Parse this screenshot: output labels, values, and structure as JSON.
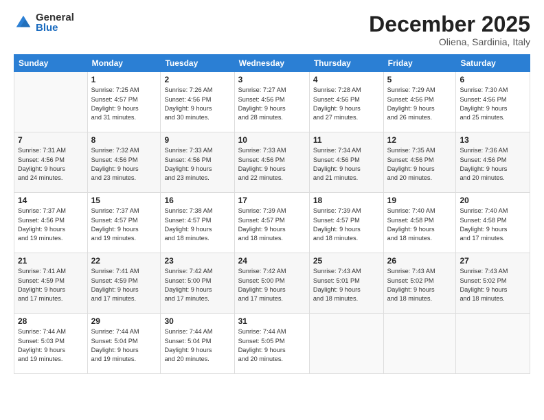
{
  "logo": {
    "general": "General",
    "blue": "Blue"
  },
  "title": "December 2025",
  "subtitle": "Oliena, Sardinia, Italy",
  "days_header": [
    "Sunday",
    "Monday",
    "Tuesday",
    "Wednesday",
    "Thursday",
    "Friday",
    "Saturday"
  ],
  "weeks": [
    [
      {
        "day": "",
        "detail": ""
      },
      {
        "day": "1",
        "detail": "Sunrise: 7:25 AM\nSunset: 4:57 PM\nDaylight: 9 hours\nand 31 minutes."
      },
      {
        "day": "2",
        "detail": "Sunrise: 7:26 AM\nSunset: 4:56 PM\nDaylight: 9 hours\nand 30 minutes."
      },
      {
        "day": "3",
        "detail": "Sunrise: 7:27 AM\nSunset: 4:56 PM\nDaylight: 9 hours\nand 28 minutes."
      },
      {
        "day": "4",
        "detail": "Sunrise: 7:28 AM\nSunset: 4:56 PM\nDaylight: 9 hours\nand 27 minutes."
      },
      {
        "day": "5",
        "detail": "Sunrise: 7:29 AM\nSunset: 4:56 PM\nDaylight: 9 hours\nand 26 minutes."
      },
      {
        "day": "6",
        "detail": "Sunrise: 7:30 AM\nSunset: 4:56 PM\nDaylight: 9 hours\nand 25 minutes."
      }
    ],
    [
      {
        "day": "7",
        "detail": "Sunrise: 7:31 AM\nSunset: 4:56 PM\nDaylight: 9 hours\nand 24 minutes."
      },
      {
        "day": "8",
        "detail": "Sunrise: 7:32 AM\nSunset: 4:56 PM\nDaylight: 9 hours\nand 23 minutes."
      },
      {
        "day": "9",
        "detail": "Sunrise: 7:33 AM\nSunset: 4:56 PM\nDaylight: 9 hours\nand 23 minutes."
      },
      {
        "day": "10",
        "detail": "Sunrise: 7:33 AM\nSunset: 4:56 PM\nDaylight: 9 hours\nand 22 minutes."
      },
      {
        "day": "11",
        "detail": "Sunrise: 7:34 AM\nSunset: 4:56 PM\nDaylight: 9 hours\nand 21 minutes."
      },
      {
        "day": "12",
        "detail": "Sunrise: 7:35 AM\nSunset: 4:56 PM\nDaylight: 9 hours\nand 20 minutes."
      },
      {
        "day": "13",
        "detail": "Sunrise: 7:36 AM\nSunset: 4:56 PM\nDaylight: 9 hours\nand 20 minutes."
      }
    ],
    [
      {
        "day": "14",
        "detail": "Sunrise: 7:37 AM\nSunset: 4:56 PM\nDaylight: 9 hours\nand 19 minutes."
      },
      {
        "day": "15",
        "detail": "Sunrise: 7:37 AM\nSunset: 4:57 PM\nDaylight: 9 hours\nand 19 minutes."
      },
      {
        "day": "16",
        "detail": "Sunrise: 7:38 AM\nSunset: 4:57 PM\nDaylight: 9 hours\nand 18 minutes."
      },
      {
        "day": "17",
        "detail": "Sunrise: 7:39 AM\nSunset: 4:57 PM\nDaylight: 9 hours\nand 18 minutes."
      },
      {
        "day": "18",
        "detail": "Sunrise: 7:39 AM\nSunset: 4:57 PM\nDaylight: 9 hours\nand 18 minutes."
      },
      {
        "day": "19",
        "detail": "Sunrise: 7:40 AM\nSunset: 4:58 PM\nDaylight: 9 hours\nand 18 minutes."
      },
      {
        "day": "20",
        "detail": "Sunrise: 7:40 AM\nSunset: 4:58 PM\nDaylight: 9 hours\nand 17 minutes."
      }
    ],
    [
      {
        "day": "21",
        "detail": "Sunrise: 7:41 AM\nSunset: 4:59 PM\nDaylight: 9 hours\nand 17 minutes."
      },
      {
        "day": "22",
        "detail": "Sunrise: 7:41 AM\nSunset: 4:59 PM\nDaylight: 9 hours\nand 17 minutes."
      },
      {
        "day": "23",
        "detail": "Sunrise: 7:42 AM\nSunset: 5:00 PM\nDaylight: 9 hours\nand 17 minutes."
      },
      {
        "day": "24",
        "detail": "Sunrise: 7:42 AM\nSunset: 5:00 PM\nDaylight: 9 hours\nand 17 minutes."
      },
      {
        "day": "25",
        "detail": "Sunrise: 7:43 AM\nSunset: 5:01 PM\nDaylight: 9 hours\nand 18 minutes."
      },
      {
        "day": "26",
        "detail": "Sunrise: 7:43 AM\nSunset: 5:02 PM\nDaylight: 9 hours\nand 18 minutes."
      },
      {
        "day": "27",
        "detail": "Sunrise: 7:43 AM\nSunset: 5:02 PM\nDaylight: 9 hours\nand 18 minutes."
      }
    ],
    [
      {
        "day": "28",
        "detail": "Sunrise: 7:44 AM\nSunset: 5:03 PM\nDaylight: 9 hours\nand 19 minutes."
      },
      {
        "day": "29",
        "detail": "Sunrise: 7:44 AM\nSunset: 5:04 PM\nDaylight: 9 hours\nand 19 minutes."
      },
      {
        "day": "30",
        "detail": "Sunrise: 7:44 AM\nSunset: 5:04 PM\nDaylight: 9 hours\nand 20 minutes."
      },
      {
        "day": "31",
        "detail": "Sunrise: 7:44 AM\nSunset: 5:05 PM\nDaylight: 9 hours\nand 20 minutes."
      },
      {
        "day": "",
        "detail": ""
      },
      {
        "day": "",
        "detail": ""
      },
      {
        "day": "",
        "detail": ""
      }
    ]
  ]
}
